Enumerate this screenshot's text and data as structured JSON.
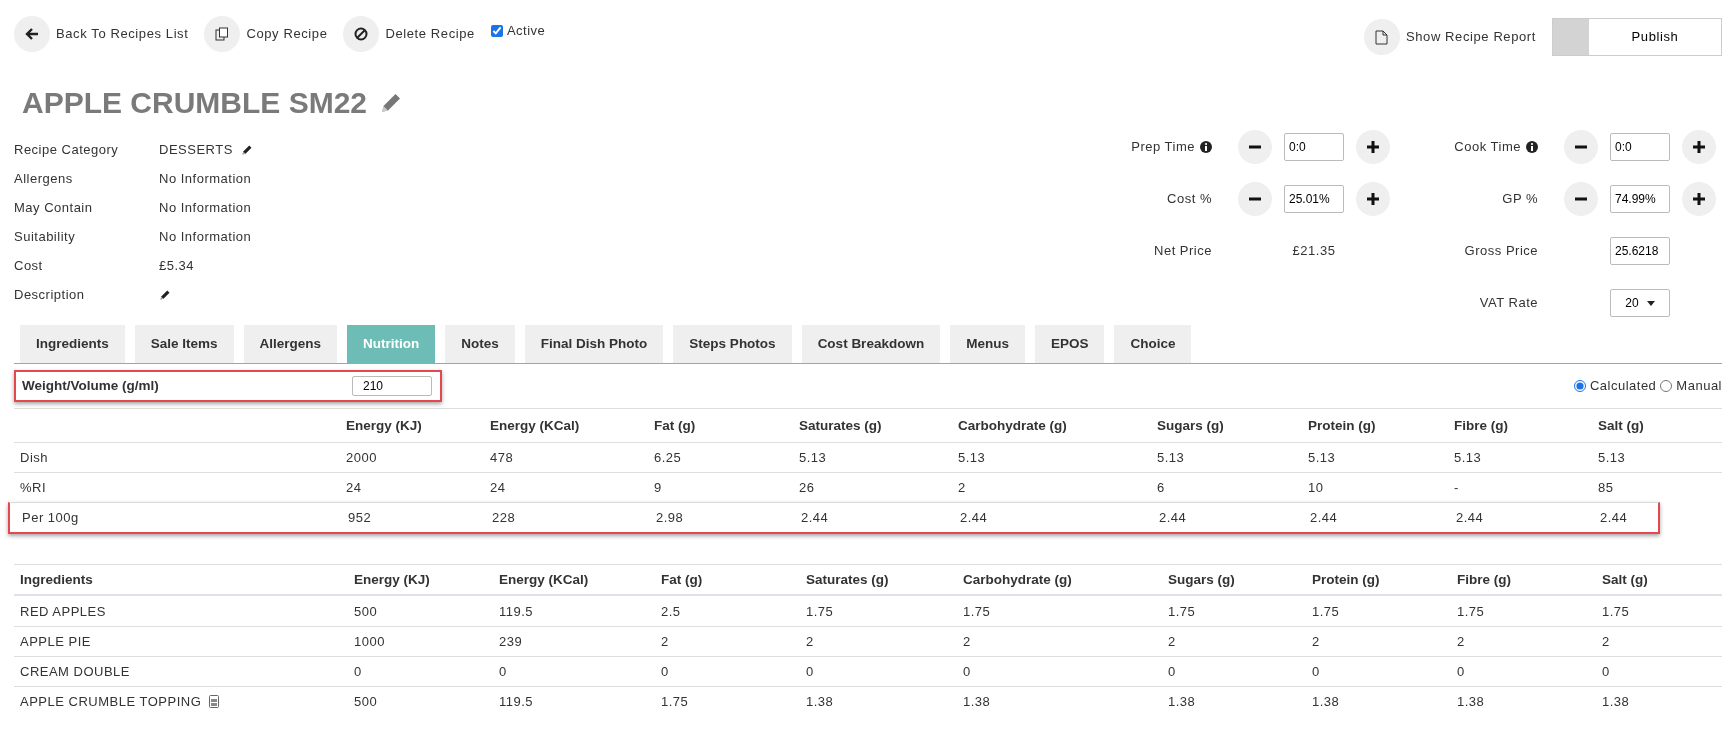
{
  "toolbar": {
    "actions": [
      {
        "kind": "back",
        "label": "Back To Recipes List"
      },
      {
        "kind": "copy",
        "label": "Copy Recipe"
      },
      {
        "kind": "delete",
        "label": "Delete Recipe"
      }
    ],
    "active": {
      "label": "Active",
      "checked": true
    },
    "report": {
      "label": "Show Recipe Report"
    },
    "publish": {
      "label": "Publish",
      "on": false
    }
  },
  "title": "APPLE CRUMBLE SM22",
  "details": [
    {
      "label": "Recipe Category",
      "value": "DESSERTS",
      "editable": true
    },
    {
      "label": "Allergens",
      "value": "No Information",
      "editable": false
    },
    {
      "label": "May Contain",
      "value": "No Information",
      "editable": false
    },
    {
      "label": "Suitability",
      "value": "No Information",
      "editable": false
    },
    {
      "label": "Cost",
      "value": "£5.34",
      "editable": false
    },
    {
      "label": "Description",
      "editable": true
    }
  ],
  "pricing": {
    "steppers": [
      {
        "label": "Prep Time",
        "value": "0:0",
        "info": true
      },
      {
        "label": "Cook Time",
        "value": "0:0",
        "info": true
      },
      {
        "label": "Cost %",
        "value": "25.01%",
        "info": false
      },
      {
        "label": "GP %",
        "value": "74.99%",
        "info": false
      }
    ],
    "net_price": {
      "label": "Net Price",
      "value": "£21.35"
    },
    "gross_price": {
      "label": "Gross Price",
      "value": "25.6218"
    },
    "vat_rate": {
      "label": "VAT Rate",
      "value": "20"
    }
  },
  "tabs": [
    {
      "label": "Ingredients",
      "selected": false
    },
    {
      "label": "Sale Items",
      "selected": false
    },
    {
      "label": "Allergens",
      "selected": false
    },
    {
      "label": "Nutrition",
      "selected": true
    },
    {
      "label": "Notes",
      "selected": false
    },
    {
      "label": "Final Dish Photo",
      "selected": false
    },
    {
      "label": "Steps Photos",
      "selected": false
    },
    {
      "label": "Cost Breakdown",
      "selected": false
    },
    {
      "label": "Menus",
      "selected": false
    },
    {
      "label": "EPOS",
      "selected": false
    },
    {
      "label": "Choice",
      "selected": false
    }
  ],
  "nutrition": {
    "weight": {
      "label": "Weight/Volume (g/ml)",
      "value": "210",
      "highlighted": true
    },
    "modes": [
      {
        "label": "Calculated",
        "selected": true
      },
      {
        "label": "Manual",
        "selected": false
      }
    ],
    "columns": [
      "Energy (KJ)",
      "Energy (KCal)",
      "Fat (g)",
      "Saturates (g)",
      "Carbohydrate (g)",
      "Sugars (g)",
      "Protein (g)",
      "Fibre (g)",
      "Salt (g)"
    ],
    "rows": [
      {
        "label": "Dish",
        "highlighted": false,
        "values": [
          "2000",
          "478",
          "6.25",
          "5.13",
          "5.13",
          "5.13",
          "5.13",
          "5.13",
          "5.13"
        ]
      },
      {
        "label": "%RI",
        "highlighted": false,
        "values": [
          "24",
          "24",
          "9",
          "26",
          "2",
          "6",
          "10",
          "-",
          "85"
        ]
      },
      {
        "label": "Per 100g",
        "highlighted": true,
        "values": [
          "952",
          "228",
          "2.98",
          "2.44",
          "2.44",
          "2.44",
          "2.44",
          "2.44",
          "2.44"
        ]
      }
    ]
  },
  "ingredients": {
    "columns": [
      "Ingredients",
      "Energy (KJ)",
      "Energy (KCal)",
      "Fat (g)",
      "Saturates (g)",
      "Carbohydrate (g)",
      "Sugars (g)",
      "Protein (g)",
      "Fibre (g)",
      "Salt (g)"
    ],
    "rows": [
      {
        "name": "RED APPLES",
        "sub_recipe": false,
        "values": [
          "500",
          "119.5",
          "2.5",
          "1.75",
          "1.75",
          "1.75",
          "1.75",
          "1.75",
          "1.75"
        ]
      },
      {
        "name": "APPLE PIE",
        "sub_recipe": false,
        "values": [
          "1000",
          "239",
          "2",
          "2",
          "2",
          "2",
          "2",
          "2",
          "2"
        ]
      },
      {
        "name": "CREAM DOUBLE",
        "sub_recipe": false,
        "values": [
          "0",
          "0",
          "0",
          "0",
          "0",
          "0",
          "0",
          "0",
          "0"
        ]
      },
      {
        "name": "APPLE CRUMBLE TOPPING",
        "sub_recipe": true,
        "values": [
          "500",
          "119.5",
          "1.75",
          "1.38",
          "1.38",
          "1.38",
          "1.38",
          "1.38",
          "1.38"
        ]
      }
    ]
  }
}
